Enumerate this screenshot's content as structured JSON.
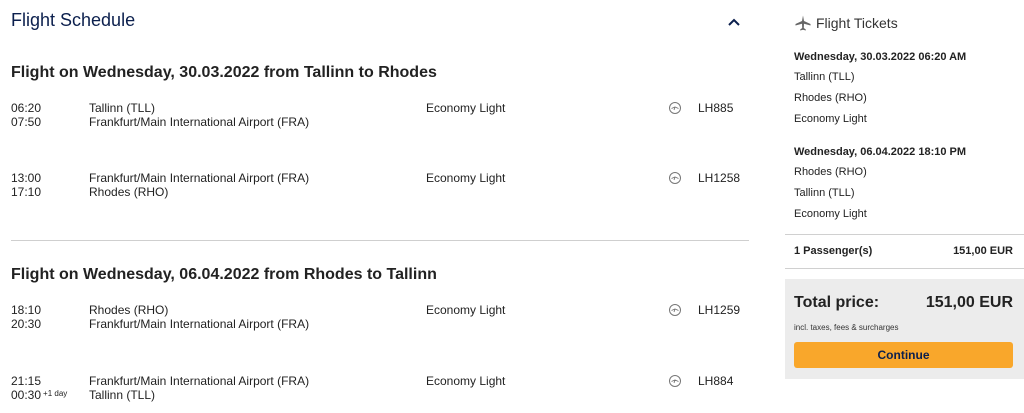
{
  "schedule": {
    "title": "Flight Schedule",
    "outbound": {
      "heading": "Flight on Wednesday, 30.03.2022 from Tallinn to Rhodes",
      "segments": [
        {
          "dep_time": "06:20",
          "arr_time": "07:50",
          "arr_offset": "",
          "from": "Tallinn (TLL)",
          "to": "Frankfurt/Main International Airport (FRA)",
          "cabin": "Economy Light",
          "flight_no": "LH885"
        },
        {
          "dep_time": "13:00",
          "arr_time": "17:10",
          "arr_offset": "",
          "from": "Frankfurt/Main International Airport (FRA)",
          "to": "Rhodes (RHO)",
          "cabin": "Economy Light",
          "flight_no": "LH1258"
        }
      ]
    },
    "inbound": {
      "heading": "Flight on Wednesday, 06.04.2022 from Rhodes to Tallinn",
      "segments": [
        {
          "dep_time": "18:10",
          "arr_time": "20:30",
          "arr_offset": "",
          "from": "Rhodes (RHO)",
          "to": "Frankfurt/Main International Airport (FRA)",
          "cabin": "Economy Light",
          "flight_no": "LH1259"
        },
        {
          "dep_time": "21:15",
          "arr_time": "00:30",
          "arr_offset": "+1 day",
          "from": "Frankfurt/Main International Airport (FRA)",
          "to": "Tallinn (TLL)",
          "cabin": "Economy Light",
          "flight_no": "LH884"
        }
      ]
    }
  },
  "tickets": {
    "title": "Flight Tickets",
    "outbound": {
      "datetime": "Wednesday, 30.03.2022 06:20 AM",
      "from": "Tallinn (TLL)",
      "to": "Rhodes (RHO)",
      "cabin": "Economy Light"
    },
    "inbound": {
      "datetime": "Wednesday, 06.04.2022 18:10 PM",
      "from": "Rhodes (RHO)",
      "to": "Tallinn (TLL)",
      "cabin": "Economy Light"
    },
    "passengers": "1 Passenger(s)",
    "passengers_price": "151,00 EUR"
  },
  "total": {
    "label": "Total price:",
    "value": "151,00 EUR",
    "note": "incl. taxes, fees & surcharges",
    "continue_label": "Continue"
  },
  "colors": {
    "accent": "#f9a72b",
    "heading": "#0b1f4d",
    "panel": "#ececec"
  },
  "icons": {
    "collapse": "chevron-up-icon",
    "tickets": "airplane-icon",
    "airline": "lufthansa-crane-icon"
  }
}
